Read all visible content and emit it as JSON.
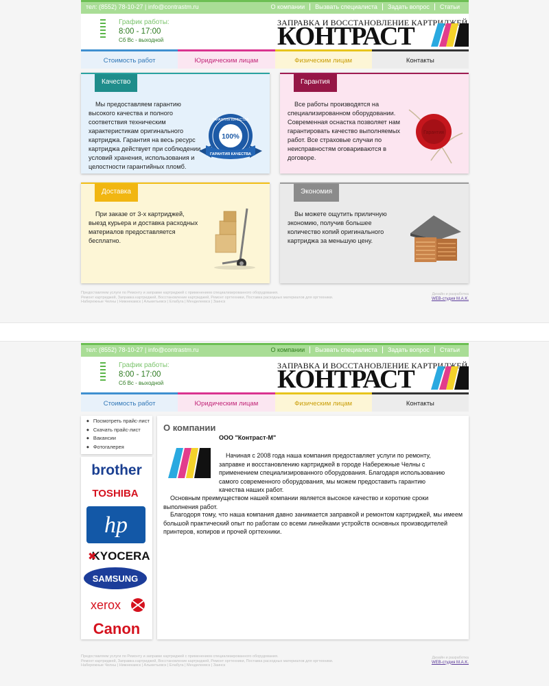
{
  "topbar": {
    "contacts": "тел: (8552) 78-10-27 | info@contrastm.ru",
    "nav": [
      "О компании",
      "Вызвать специалиста",
      "Задать вопрос",
      "Статьи"
    ]
  },
  "schedule": {
    "label": "График работы:",
    "hours": "8:00 - 17:00",
    "note": "Сб Вс - выходной"
  },
  "logo": {
    "tagline": "ЗАПРАВКА И ВОССТАНОВЛЕНИЕ КАРТРИДЖЕЙ",
    "name": "КОНТРАСТ"
  },
  "menu": [
    "Стоимость работ",
    "Юридическим лицам",
    "Физическим лицам",
    "Контакты"
  ],
  "cards": [
    {
      "title": "Качество",
      "text": "Мы предоставляем гарантию высокого качества и полного соответствия техническим характеристикам оригинального картриджа. Гарантия на весь ресурс картриджа действует при соблюдении условий хранения, использования и целостности гарантийных пломб.",
      "badge": {
        "top": "ГАРАНТИЯ КАЧЕСТВА",
        "value": "100%",
        "ribbon": "ГАРАНТИЯ КАЧЕСТВА"
      }
    },
    {
      "title": "Гарантия",
      "text": "Все работы производятся на специализированном оборудовании. Современная оснастка позволяет нам гарантировать качество выполняемых работ. Все страховые случаи по неисправностям оговариваются в договоре.",
      "seal": "Гарантия"
    },
    {
      "title": "Доставка",
      "text": "При заказе от 3-х картриджей, выезд курьера и доставка расходных материалов предоставляется бесплатно."
    },
    {
      "title": "Экономия",
      "text": "Вы можете ощутить приличную экономию, получив большее количество копий оригинального картриджа за меньшую цену."
    }
  ],
  "footer": {
    "lines": [
      "Предоставляем услуги по Ремонту и заправке картриджей с применением специализированного оборудования.",
      "Ремонт картриджей, Заправка картриджей, Восстановление картриджей, Ремонт оргтехники, Поставка расходных материалов для оргтехники.",
      "Набережные Челны | Нижнекамск | Альметьевск | Елабуга | Менделеевск | Заинск"
    ],
    "credit": "Дизайн и разработка",
    "studio": "WEB-студия M.A.K."
  },
  "sidebar": [
    "Посмотреть прайс-лист",
    "Скачать прайс-лист",
    "Вакансии",
    "Фотогалерея"
  ],
  "brands": [
    "brother",
    "TOSHIBA",
    "hp",
    "KYOCERA",
    "SAMSUNG",
    "xerox",
    "Canon"
  ],
  "about": {
    "title": "О компании",
    "company": "ООО \"Контраст-М\"",
    "p1": "Начиная с 2008 года наша компания предоставляет услуги по ремонту, заправке и восстановлению картриджей в городе Набережные Челны с применением специализированного оборудования. Благодаря использованию самого современного оборудования, мы можем предоставить гарантию качества наших работ.",
    "p2": "Основным преимуществом нашей компании является высокое качество и короткие сроки выполнения работ.",
    "p3": "Благодоря тому, что наша компания давно занимается заправкой и ремонтом картриджей, мы имеем большой практический опыт по работам со всеми линейками устройств основных производителей принтеров, копиров и прочей оргтехники."
  },
  "colors": {
    "green": "#a9dd96",
    "blue": "#3e8fd0",
    "magenta": "#d9338f",
    "yellow": "#e7c41c",
    "dark": "#333333"
  }
}
